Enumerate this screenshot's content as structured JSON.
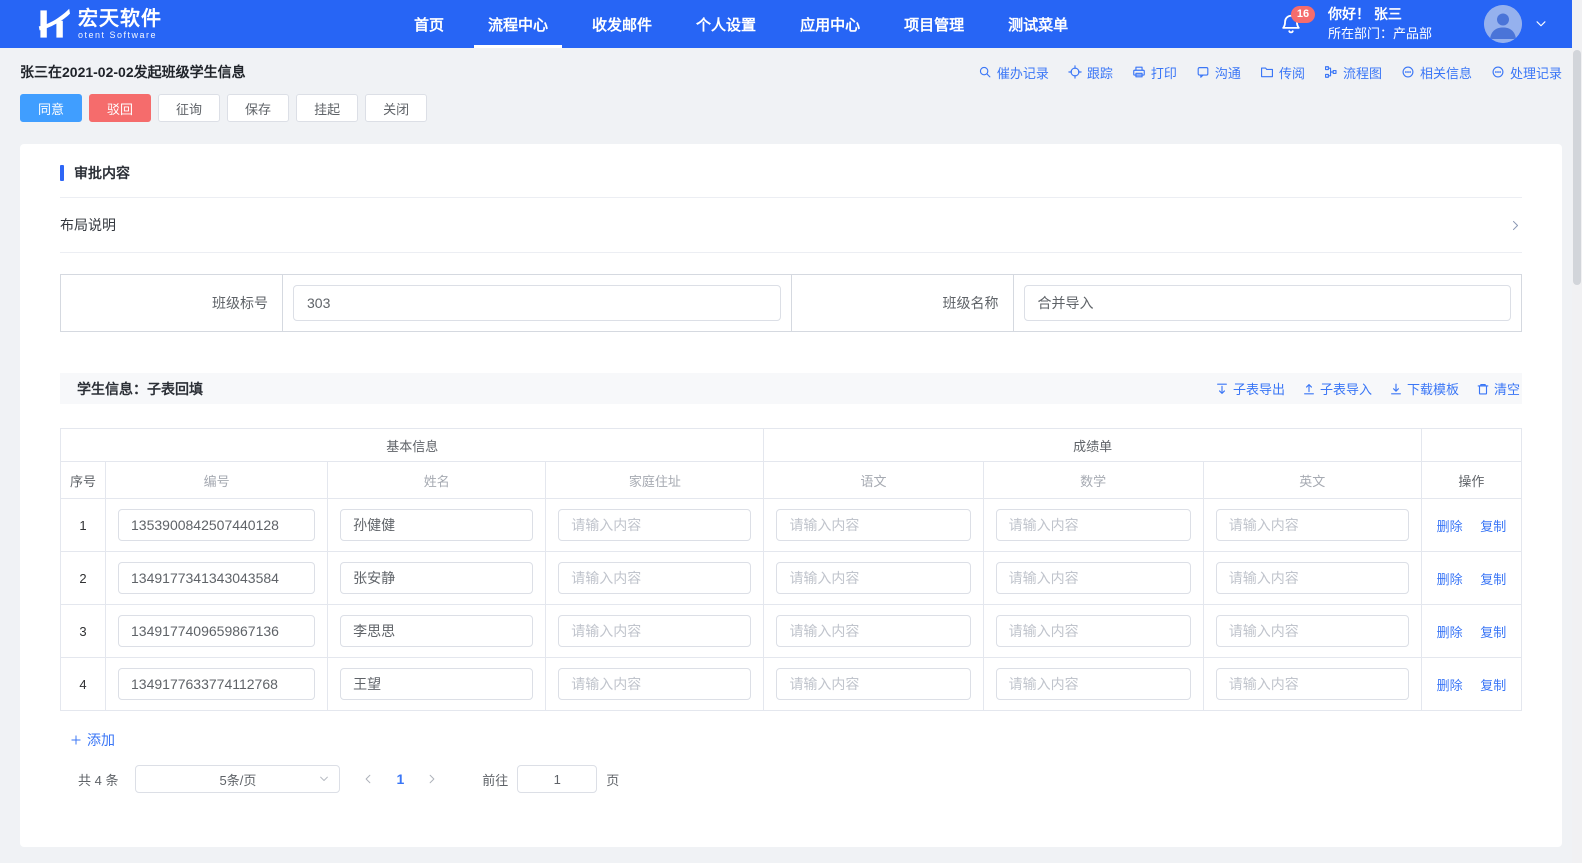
{
  "colors": {
    "navbar_bg": "#2765f5",
    "primary_button": "#409eff",
    "danger_button": "#f56c6c",
    "link_blue": "#3a76f6",
    "badge_red": "#f56c6c",
    "page_bg": "#f0f2f5"
  },
  "navbar": {
    "brand": {
      "title": "宏天软件",
      "subtitle": "otent Software"
    },
    "items": [
      {
        "label": "首页"
      },
      {
        "label": "流程中心",
        "active": true
      },
      {
        "label": "收发邮件"
      },
      {
        "label": "个人设置"
      },
      {
        "label": "应用中心"
      },
      {
        "label": "项目管理"
      },
      {
        "label": "测试菜单"
      }
    ],
    "notification_count": "16",
    "greeting": "你好！ 张三",
    "department": "所在部门：产品部"
  },
  "toolbar": {
    "title": "张三在2021-02-02发起班级学生信息",
    "actions": [
      {
        "label": "催办记录",
        "icon": "search"
      },
      {
        "label": "跟踪",
        "icon": "track"
      },
      {
        "label": "打印",
        "icon": "print"
      },
      {
        "label": "沟通",
        "icon": "chat"
      },
      {
        "label": "传阅",
        "icon": "folder"
      },
      {
        "label": "流程图",
        "icon": "flow"
      },
      {
        "label": "相关信息",
        "icon": "comment"
      },
      {
        "label": "处理记录",
        "icon": "comment"
      }
    ],
    "buttons": [
      {
        "label": "同意",
        "type": "primary"
      },
      {
        "label": "驳回",
        "type": "danger"
      },
      {
        "label": "征询",
        "type": "plain"
      },
      {
        "label": "保存",
        "type": "plain"
      },
      {
        "label": "挂起",
        "type": "plain"
      },
      {
        "label": "关闭",
        "type": "plain"
      }
    ]
  },
  "content": {
    "section_title": "审批内容",
    "layout_note": "布局说明",
    "form_fields": [
      {
        "label": "班级标号",
        "value": "303"
      },
      {
        "label": "班级名称",
        "value": "合并导入"
      }
    ],
    "subtable": {
      "title": "学生信息：子表回填",
      "tools": [
        {
          "label": "子表导出",
          "icon": "export"
        },
        {
          "label": "子表导入",
          "icon": "import"
        },
        {
          "label": "下载模板",
          "icon": "download"
        },
        {
          "label": "清空",
          "icon": "trash"
        }
      ],
      "groups": [
        {
          "label": "基本信息",
          "span": "4"
        },
        {
          "label": "成绩单",
          "span": "3"
        },
        {
          "label": "",
          "span": "1"
        }
      ],
      "columns": [
        {
          "label": "序号"
        },
        {
          "label": "编号",
          "muted": true
        },
        {
          "label": "姓名",
          "muted": true
        },
        {
          "label": "家庭住址",
          "muted": true
        },
        {
          "label": "语文",
          "muted": true
        },
        {
          "label": "数学",
          "muted": true
        },
        {
          "label": "英文",
          "muted": true
        },
        {
          "label": "操作"
        }
      ],
      "input_placeholder": "请输入内容",
      "rows": [
        {
          "index": "1",
          "id": "1353900842507440128",
          "name": "孙健健"
        },
        {
          "index": "2",
          "id": "1349177341343043584",
          "name": "张安静"
        },
        {
          "index": "3",
          "id": "1349177409659867136",
          "name": "李思思"
        },
        {
          "index": "4",
          "id": "1349177633774112768",
          "name": "王望"
        }
      ],
      "row_actions": [
        {
          "label": "删除"
        },
        {
          "label": "复制"
        }
      ],
      "add_label": "添加",
      "pagination": {
        "total": "共 4 条",
        "page_size": "5条/页",
        "current_page": "1",
        "goto_label": "前往",
        "goto_value": "1",
        "goto_unit": "页"
      }
    }
  }
}
